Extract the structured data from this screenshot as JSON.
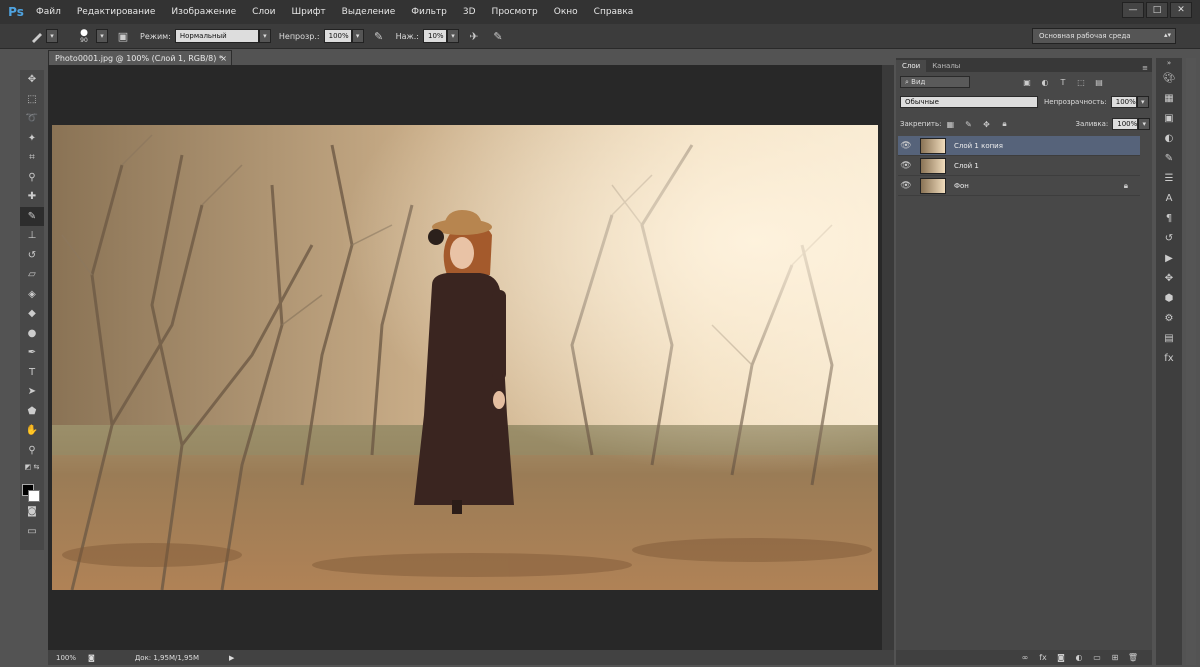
{
  "app": {
    "logo": "Ps",
    "menu": [
      "Файл",
      "Редактирование",
      "Изображение",
      "Слои",
      "Шрифт",
      "Выделение",
      "Фильтр",
      "3D",
      "Просмотр",
      "Окно",
      "Справка"
    ],
    "window_controls": [
      "—",
      "□",
      "✕"
    ]
  },
  "options_bar": {
    "brush_size": "90",
    "mode_label": "Режим:",
    "mode_value": "Нормальный",
    "opacity_label": "Непрозр.:",
    "opacity_value": "100%",
    "flow_label": "Наж.:",
    "flow_value": "10%",
    "workspace": "Основная рабочая среда"
  },
  "document": {
    "tab_title": "Photo0001.jpg @ 100% (Слой 1, RGB/8) *",
    "tab_close": "×",
    "zoom": "100%",
    "doc_size": "Док: 1,95M/1,95M"
  },
  "layers_panel": {
    "tabs": [
      "Слои",
      "Каналы"
    ],
    "filter_label": "Вид",
    "blend_mode": "Обычные",
    "opacity_label": "Непрозрачность:",
    "opacity_value": "100%",
    "lock_label": "Закрепить:",
    "fill_label": "Заливка:",
    "fill_value": "100%",
    "layers": [
      {
        "name": "Слой 1 копия",
        "selected": true
      },
      {
        "name": "Слой 1",
        "selected": false
      },
      {
        "name": "Фон",
        "selected": false,
        "locked": true
      }
    ]
  },
  "colors": {
    "accent": "#4fa3e0",
    "selected_layer": "#56637a"
  }
}
